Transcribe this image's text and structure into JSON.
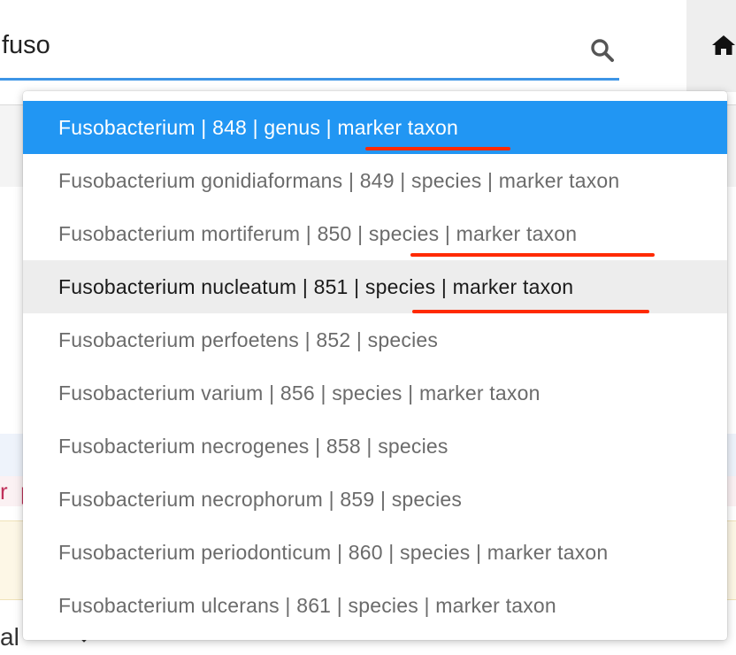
{
  "search": {
    "value": "fuso"
  },
  "icons": {
    "search": "search-icon",
    "home": "home-icon",
    "select_caret": "chevron-down-icon"
  },
  "background": {
    "pink_text": "r  p",
    "select_value": "al"
  },
  "colors": {
    "accent": "#2196f3",
    "search_underline": "#3d95e6",
    "annotation": "#ff2a00"
  },
  "dropdown": {
    "options": [
      {
        "label": "Fusobacterium | 848 | genus | marker taxon"
      },
      {
        "label": "Fusobacterium gonidiaformans | 849 | species | marker taxon"
      },
      {
        "label": "Fusobacterium mortiferum | 850 | species | marker taxon"
      },
      {
        "label": "Fusobacterium nucleatum | 851 | species | marker taxon"
      },
      {
        "label": "Fusobacterium perfoetens | 852 | species"
      },
      {
        "label": "Fusobacterium varium | 856 | species | marker taxon"
      },
      {
        "label": "Fusobacterium necrogenes | 858 | species"
      },
      {
        "label": "Fusobacterium necrophorum | 859 | species"
      },
      {
        "label": "Fusobacterium periodonticum | 860 | species | marker taxon"
      },
      {
        "label": "Fusobacterium ulcerans | 861 | species | marker taxon"
      }
    ]
  }
}
